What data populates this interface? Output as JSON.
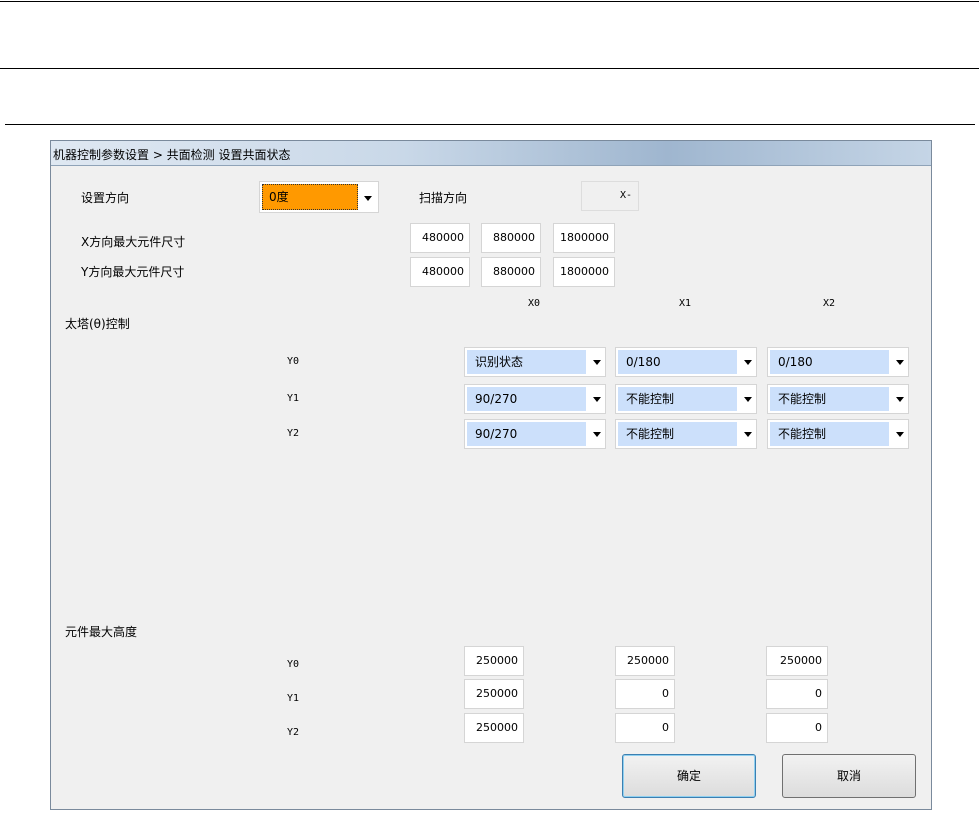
{
  "dialog": {
    "title": "机器控制参数设置 > 共面检测 设置共面状态"
  },
  "direction": {
    "label": "设置方向",
    "value": "0度",
    "scan_label": "扫描方向",
    "scan_value": "X-"
  },
  "x_max": {
    "label": "X方向最大元件尺寸",
    "values": [
      "480000",
      "880000",
      "1800000"
    ]
  },
  "y_max": {
    "label": "Y方向最大元件尺寸",
    "values": [
      "480000",
      "880000",
      "1800000"
    ]
  },
  "turret": {
    "label": "太塔(θ)控制",
    "cols": [
      "X0",
      "X1",
      "X2"
    ],
    "rows": [
      {
        "label": "Y0",
        "values": [
          "识别状态",
          "0/180",
          "0/180"
        ]
      },
      {
        "label": "Y1",
        "values": [
          "90/270",
          "不能控制",
          "不能控制"
        ]
      },
      {
        "label": "Y2",
        "values": [
          "90/270",
          "不能控制",
          "不能控制"
        ]
      }
    ]
  },
  "height": {
    "label": "元件最大高度",
    "rows": [
      {
        "label": "Y0",
        "values": [
          "250000",
          "250000",
          "250000"
        ]
      },
      {
        "label": "Y1",
        "values": [
          "250000",
          "0",
          "0"
        ]
      },
      {
        "label": "Y2",
        "values": [
          "250000",
          "0",
          "0"
        ]
      }
    ]
  },
  "buttons": {
    "ok": "确定",
    "cancel": "取消"
  },
  "colors": {
    "accent": "#ff9900",
    "combo_bg": "#cce0fb"
  }
}
